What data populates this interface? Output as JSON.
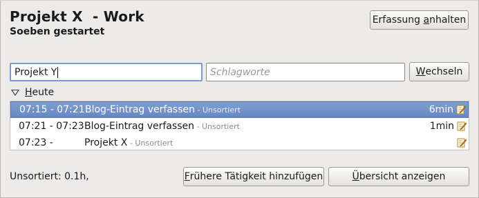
{
  "header": {
    "title": "Projekt X  - Work",
    "subtitle": "Soeben gestartet",
    "pause_button": {
      "pre": "Erfassung ",
      "mnemonic": "a",
      "post": "nhalten"
    }
  },
  "entry": {
    "activity_value": "Projekt Y",
    "tags_placeholder": "Schlagworte",
    "switch_button": {
      "pre": "",
      "mnemonic": "W",
      "post": "echseln"
    }
  },
  "today_group": {
    "label_mnemonic": "H",
    "label_rest": "eute",
    "rows": [
      {
        "time": "07:15 - 07:21",
        "activity": "Blog-Eintrag verfassen",
        "category": " - Unsortiert",
        "duration": "6min",
        "selected": true
      },
      {
        "time": "07:21 - 07:23",
        "activity": "Blog-Eintrag verfassen",
        "category": " - Unsortiert",
        "duration": "1min",
        "selected": false
      },
      {
        "time": "07:23 -",
        "activity": "Projekt X",
        "category": " - Unsortiert",
        "duration": "",
        "selected": false
      }
    ]
  },
  "footer": {
    "status": "Unsortiert: 0.1h,",
    "add_earlier_button": {
      "pre": "",
      "mnemonic": "F",
      "post": "rühere Tätigkeit hinzufügen"
    },
    "overview_button": {
      "pre": "",
      "mnemonic": "Ü",
      "post": "bersicht anzeigen"
    }
  },
  "colors": {
    "selection": "#7393ca",
    "window_bg": "#ecebea",
    "focus_border": "#7a9bd0"
  },
  "icons": {
    "row_edit": "edit-pencil-icon",
    "group_toggle": "expander-down-icon"
  }
}
